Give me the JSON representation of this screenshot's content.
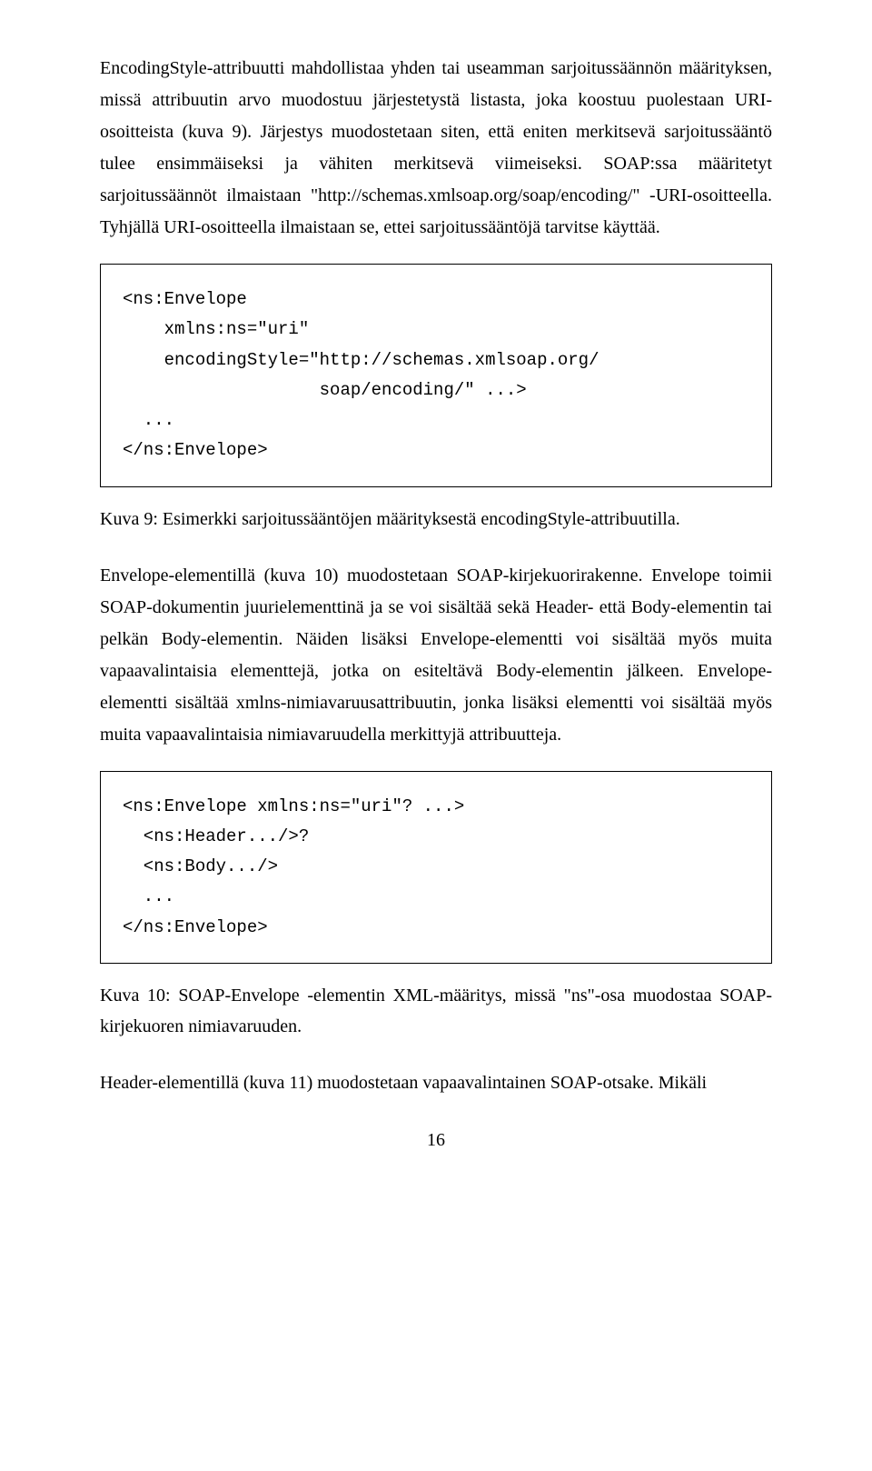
{
  "paragraphs": {
    "p1": "EncodingStyle-attribuutti mahdollistaa yhden tai useamman sarjoitussäännön määrityksen, missä attribuutin arvo muodostuu järjestetystä listasta, joka koostuu puolestaan URI-osoitteista (kuva 9). Järjestys muodostetaan siten, että eniten merkitsevä sarjoitussääntö tulee ensimmäiseksi ja vähiten merkitsevä viimeiseksi. SOAP:ssa määritetyt sarjoitussäännöt ilmaistaan \"http://schemas.xmlsoap.org/soap/encoding/\" -URI-osoitteella. Tyhjällä URI-osoitteella ilmaistaan se, ettei sarjoitussääntöjä tarvitse käyttää.",
    "p2": "Envelope-elementillä (kuva 10) muodostetaan SOAP-kirjekuorirakenne. Envelope toimii SOAP-dokumentin juurielementtinä ja se voi sisältää sekä Header- että Body-elementin tai pelkän Body-elementin. Näiden lisäksi Envelope-elementti voi sisältää myös muita vapaavalintaisia elementtejä, jotka on esiteltävä Body-elementin jälkeen. Envelope-elementti sisältää xmlns-nimiavaruusattribuutin, jonka lisäksi elementti voi sisältää myös muita vapaavalintaisia nimiavaruudella merkittyjä attribuutteja.",
    "p3": "Header-elementillä (kuva 11) muodostetaan vapaavalintainen SOAP-otsake. Mikäli"
  },
  "code": {
    "block1": "<ns:Envelope\n    xmlns:ns=\"uri\"\n    encodingStyle=\"http://schemas.xmlsoap.org/\n                   soap/encoding/\" ...>\n  ...\n</ns:Envelope>",
    "block2": "<ns:Envelope xmlns:ns=\"uri\"? ...>\n  <ns:Header.../>?\n  <ns:Body.../>\n  ...\n</ns:Envelope>"
  },
  "captions": {
    "c1": "Kuva 9: Esimerkki sarjoitussääntöjen määrityksestä encodingStyle-attribuutilla.",
    "c2": "Kuva 10: SOAP-Envelope -elementin XML-määritys, missä \"ns\"-osa muodostaa SOAP-kirjekuoren nimiavaruuden."
  },
  "page_number": "16"
}
